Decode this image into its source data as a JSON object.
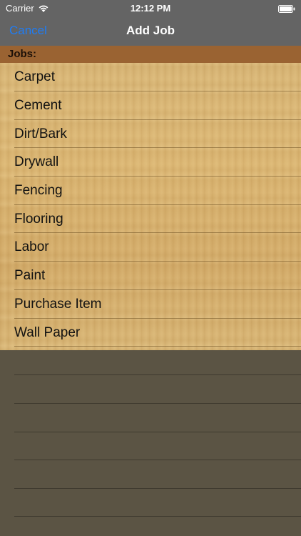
{
  "status_bar": {
    "carrier": "Carrier",
    "time": "12:12 PM",
    "wifi_icon": "wifi-icon",
    "battery_icon": "battery-icon"
  },
  "nav": {
    "cancel_label": "Cancel",
    "title": "Add Job"
  },
  "section": {
    "header": "Jobs:"
  },
  "jobs": [
    "Carpet",
    "Cement",
    "Dirt/Bark",
    "Drywall",
    "Fencing",
    "Flooring",
    "Labor",
    "Paint",
    "Purchase Item",
    "Wall Paper"
  ],
  "colors": {
    "bar": "#646464",
    "accent": "#1e7cf5",
    "section_header": "#9a6332",
    "empty_background": "#5b5444"
  }
}
